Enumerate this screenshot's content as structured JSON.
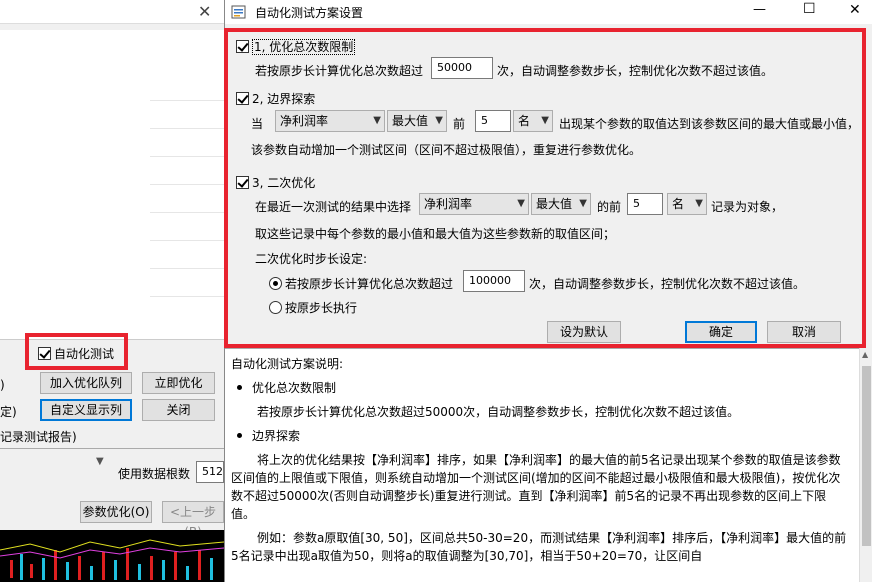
{
  "background_window": {
    "auto_test_checkbox": "自动化测试",
    "buttons": {
      "add_queue": "加入优化队列",
      "optimize_now": "立即优化",
      "custom_columns": "自定义显示列",
      "close": "关闭",
      "param_optimize": "参数优化(O)",
      "prev_step": "<上一步(B)"
    },
    "partial_labels": {
      "paren": ")",
      "fixed": "定)",
      "record_report": "记录测试报告)"
    },
    "use_data_count_label": "使用数据根数",
    "use_data_count_value": "512"
  },
  "dialog": {
    "title": "自动化测试方案设置",
    "section1": {
      "title": "1, 优化总次数限制",
      "text_before": "若按原步长计算优化总次数超过",
      "value": "50000",
      "text_after": "次，自动调整参数步长，控制优化次数不超过该值。"
    },
    "section2": {
      "title": "2, 边界探索",
      "when": "当",
      "metric": "净利润率",
      "extreme": "最大值",
      "front": "前",
      "count": "5",
      "unit": "名",
      "text_after": "出现某个参数的取值达到该参数区间的最大值或最小值，",
      "line2": "该参数自动增加一个测试区间（区间不超过极限值），重复进行参数优化。"
    },
    "section3": {
      "title": "3, 二次优化",
      "text_before": "在最近一次测试的结果中选择",
      "metric": "净利润率",
      "extreme": "最大值",
      "of_front": "的前",
      "count": "5",
      "unit": "名",
      "text_after": "记录为对象，",
      "line2": "取这些记录中每个参数的最小值和最大值为这些参数新的取值区间；",
      "step_label": "二次优化时步长设定:",
      "radio1_before": "若按原步长计算优化总次数超过",
      "radio1_value": "100000",
      "radio1_after": "次，自动调整参数步长，控制优化次数不超过该值。",
      "radio2": "按原步长执行"
    },
    "buttons": {
      "set_default": "设为默认",
      "ok": "确定",
      "cancel": "取消"
    },
    "window_controls": {
      "minimize": "—",
      "maximize": "☐",
      "close": "✕"
    }
  },
  "help": {
    "heading": "自动化测试方案说明:",
    "b1_title": "优化总次数限制",
    "b1_text": "若按原步长计算优化总次数超过50000次，自动调整参数步长，控制优化次数不超过该值。",
    "b2_title": "边界探索",
    "b2_p1": "将上次的优化结果按【净利润率】排序，如果【净利润率】的最大值的前5名记录出现某个参数的取值是该参数区间值的上限值或下限值，则系统自动增加一个测试区间(增加的区间不能超过最小极限值和最大极限值)，按优化次数不超过50000次(否则自动调整步长)重复进行测试。直到【净利润率】前5名的记录不再出现参数的区间上下限值。",
    "b2_p2": "例如：参数a原取值[30, 50]，区间总共50-30=20，而测试结果【净利润率】排序后，【净利润率】最大值的前5名记录中出现a取值为50，则将a的取值调整为[30,70]，相当于50+20=70，让区间自"
  },
  "colors": {
    "highlight_border": "#e8232f",
    "primary_button_border": "#0078d7"
  }
}
